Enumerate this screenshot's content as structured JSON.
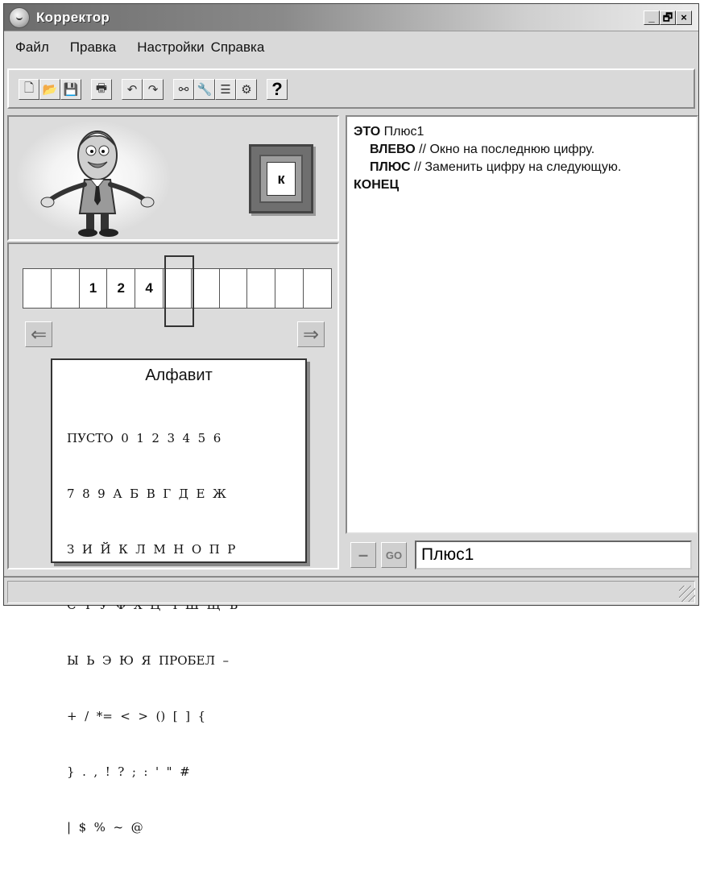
{
  "window": {
    "title": "Корректор",
    "buttons": {
      "minimize": "_",
      "restore": "🗗",
      "close": "×"
    }
  },
  "menu": [
    "Файл",
    "Правка",
    "Настройки",
    "Справка"
  ],
  "toolbar": {
    "buttons": [
      {
        "name": "new-document-icon",
        "glyph": "🗋"
      },
      {
        "name": "open-folder-icon",
        "glyph": "📂"
      },
      {
        "name": "save-icon",
        "glyph": "💾"
      },
      {
        "name": "print-icon",
        "glyph": "🖶"
      },
      {
        "name": "undo-icon",
        "glyph": "↶"
      },
      {
        "name": "redo-icon",
        "glyph": "↷"
      },
      {
        "name": "binoculars-icon",
        "glyph": "⚯"
      },
      {
        "name": "wrench-icon",
        "glyph": "🔧"
      },
      {
        "name": "list-icon",
        "glyph": "☰"
      },
      {
        "name": "gear-icon",
        "glyph": "⚙"
      }
    ],
    "help": "?"
  },
  "current_cell": "к",
  "tape": [
    "",
    "",
    "1",
    "2",
    "4",
    "",
    "",
    "",
    "",
    "",
    ""
  ],
  "alphabet": {
    "title": "Алфавит",
    "rows": [
      "ПУСТО  0  1  2  3  4  5  6",
      "7  8  9  А  Б  В  Г  Д  Е  Ж",
      "З  И  Й  К  Л  М  Н  О  П  Р",
      "С  Т  У  Ф  Х  Ц  Ч  Ш  Щ  Ъ",
      "Ы  Ь  Э  Ю  Я  ПРОБЕЛ  –",
      "+  /  *=  <  >  ()  [  ]  {",
      "}  .  ,  !  ?  ;  :  '  \"  #",
      "|  $  %  ~  @"
    ]
  },
  "editor": {
    "lines": [
      {
        "kw": "ЭТО",
        "rest": " Плюс1",
        "indent": false
      },
      {
        "kw": "ВЛЕВО",
        "rest": " // Окно на последнюю цифру.",
        "indent": true
      },
      {
        "kw": "ПЛЮС",
        "rest": "  // Заменить цифру на следующую.",
        "indent": true
      },
      {
        "kw": "КОНЕЦ",
        "rest": "",
        "indent": false
      }
    ]
  },
  "command": {
    "minus": "–",
    "go": "GO",
    "value": "Плюс1"
  },
  "arrows": {
    "left": "⇐",
    "right": "⇒"
  }
}
